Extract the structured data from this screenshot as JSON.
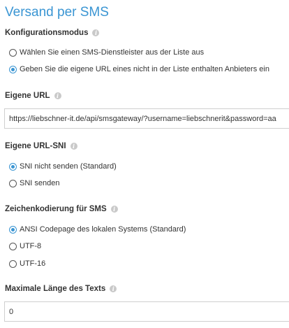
{
  "page": {
    "title": "Versand per SMS"
  },
  "config_mode": {
    "label": "Konfigurationsmodus",
    "options": [
      {
        "label": "Wählen Sie einen SMS-Dienstleister aus der Liste aus",
        "checked": false
      },
      {
        "label": "Geben Sie die eigene URL eines nicht in der Liste enthalten Anbieters ein",
        "checked": true
      }
    ]
  },
  "custom_url": {
    "label": "Eigene URL",
    "value": "https://liebschner-it.de/api/smsgateway/?username=liebschnerit&password=aa"
  },
  "custom_url_sni": {
    "label": "Eigene URL-SNI",
    "options": [
      {
        "label": "SNI nicht senden (Standard)",
        "checked": true
      },
      {
        "label": "SNI senden",
        "checked": false
      }
    ]
  },
  "encoding": {
    "label": "Zeichenkodierung für SMS",
    "options": [
      {
        "label": "ANSI Codepage des lokalen Systems (Standard)",
        "checked": true
      },
      {
        "label": "UTF-8",
        "checked": false
      },
      {
        "label": "UTF-16",
        "checked": false
      }
    ]
  },
  "max_length": {
    "label": "Maximale Länge des Texts",
    "value": "0"
  },
  "colors": {
    "accent": "#3a95d3",
    "text": "#333333",
    "info_icon": "#c9c9c9",
    "input_border": "#cfcfcf"
  },
  "icons": {
    "info": "info-icon"
  }
}
